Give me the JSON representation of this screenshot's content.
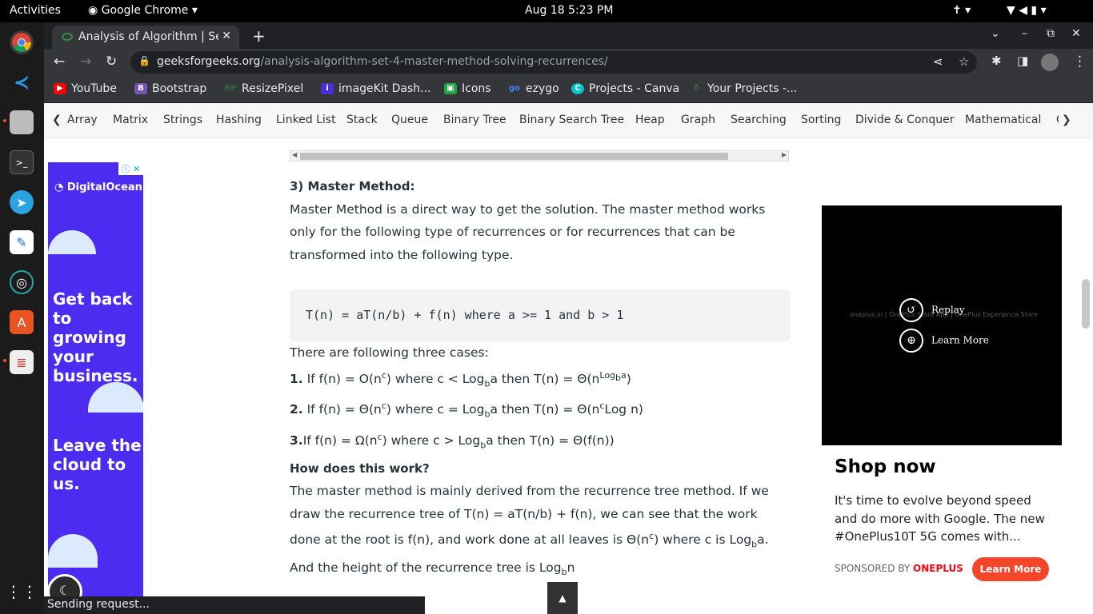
{
  "system": {
    "activities": "Activities",
    "app": "Google Chrome",
    "datetime": "Aug 18  5:23 PM"
  },
  "browser": {
    "tab_title": "Analysis of Algorithm | Se",
    "url_host": "geeksforgeeks.org",
    "url_path": "/analysis-algorithm-set-4-master-method-solving-recurrences/",
    "bookmarks": [
      "YouTube",
      "Bootstrap",
      "ResizePixel",
      "imageKit Dash...",
      "Icons",
      "ezygo",
      "Projects - Canva",
      "Your Projects -..."
    ],
    "bookmark_icon_colors": [
      "#ff0000",
      "#7952b3",
      "#2d6b3f",
      "#4f2dd6",
      "#1ea446",
      "#4285f4",
      "#00c4cc",
      "#3a8e43"
    ]
  },
  "categories": [
    "Array",
    "Matrix",
    "Strings",
    "Hashing",
    "Linked List",
    "Stack",
    "Queue",
    "Binary Tree",
    "Binary Search Tree",
    "Heap",
    "Graph",
    "Searching",
    "Sorting",
    "Divide & Conquer",
    "Mathematical",
    "G"
  ],
  "article": {
    "heading": "3) Master Method:",
    "intro": "Master Method is a direct way to get the solution. The master method works only for the following type of recurrences or for recurrences that can be transformed into the following type.",
    "code": "T(n) = aT(n/b) + f(n) where a >= 1 and b > 1",
    "cases_intro": "There are following three cases:",
    "how_heading": "How does this work?",
    "how_text_1": "The master method is mainly derived from the recurrence tree method. If we draw the recurrence tree of T(n) = aT(n/b) + f(n), we can see that the work done at the root is f(n), and work done at all leaves is Θ(n",
    "how_text_2": ") where c is Log",
    "how_text_3": "a. And the height of the recurrence tree is Log",
    "how_text_4": "n"
  },
  "ad_left": {
    "brand": "DigitalOcean",
    "headline1": "Get back to growing your business.",
    "headline2": "Leave the cloud to us."
  },
  "ad_right": {
    "replay": "Replay",
    "learn_more_video": "Learn More",
    "title": "Shop now",
    "description": "It's time to evolve beyond speed and do more with Google. The new #OnePlus10T 5G comes with...",
    "sponsored_by": "SPONSORED BY",
    "sponsor": "ONEPLUS",
    "cta": "Learn More"
  },
  "status_text": "Sending request..."
}
